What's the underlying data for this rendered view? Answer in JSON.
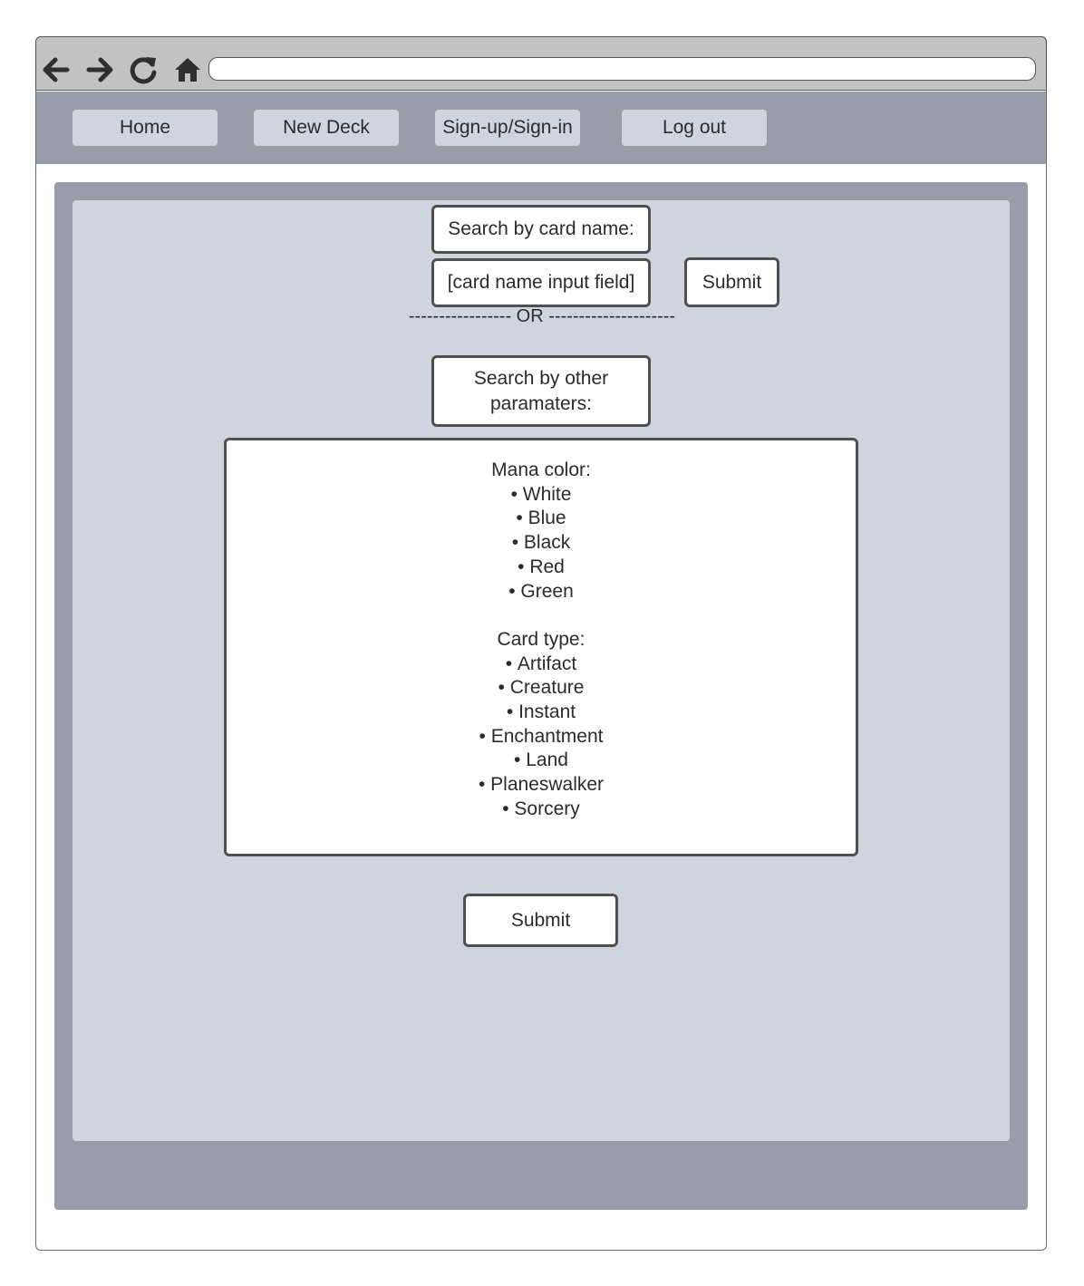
{
  "browser": {
    "icons": [
      "back-arrow-icon",
      "forward-arrow-icon",
      "reload-icon",
      "home-icon"
    ],
    "address": ""
  },
  "nav": {
    "home": "Home",
    "new_deck": "New Deck",
    "sign": "Sign-up/Sign-in",
    "logout": "Log out"
  },
  "search": {
    "name_label": "Search by card name:",
    "name_input": "[card name input field]",
    "submit": "Submit",
    "or_divider": "----------------- OR ---------------------",
    "other_label": "Search by other paramaters:"
  },
  "params": {
    "mana_heading": "Mana color:",
    "mana_colors": [
      "White",
      "Blue",
      "Black",
      "Red",
      "Green"
    ],
    "type_heading": "Card type:",
    "card_types": [
      "Artifact",
      "Creature",
      "Instant",
      "Enchantment",
      "Land",
      "Planeswalker",
      "Sorcery"
    ]
  },
  "bottom_submit": "Submit",
  "colors": {
    "frame_gray": "#979ea9",
    "panel_light": "#cfd5de",
    "toolbar_gray": "#c2c2c2",
    "border_dark": "#4f4f4f"
  }
}
